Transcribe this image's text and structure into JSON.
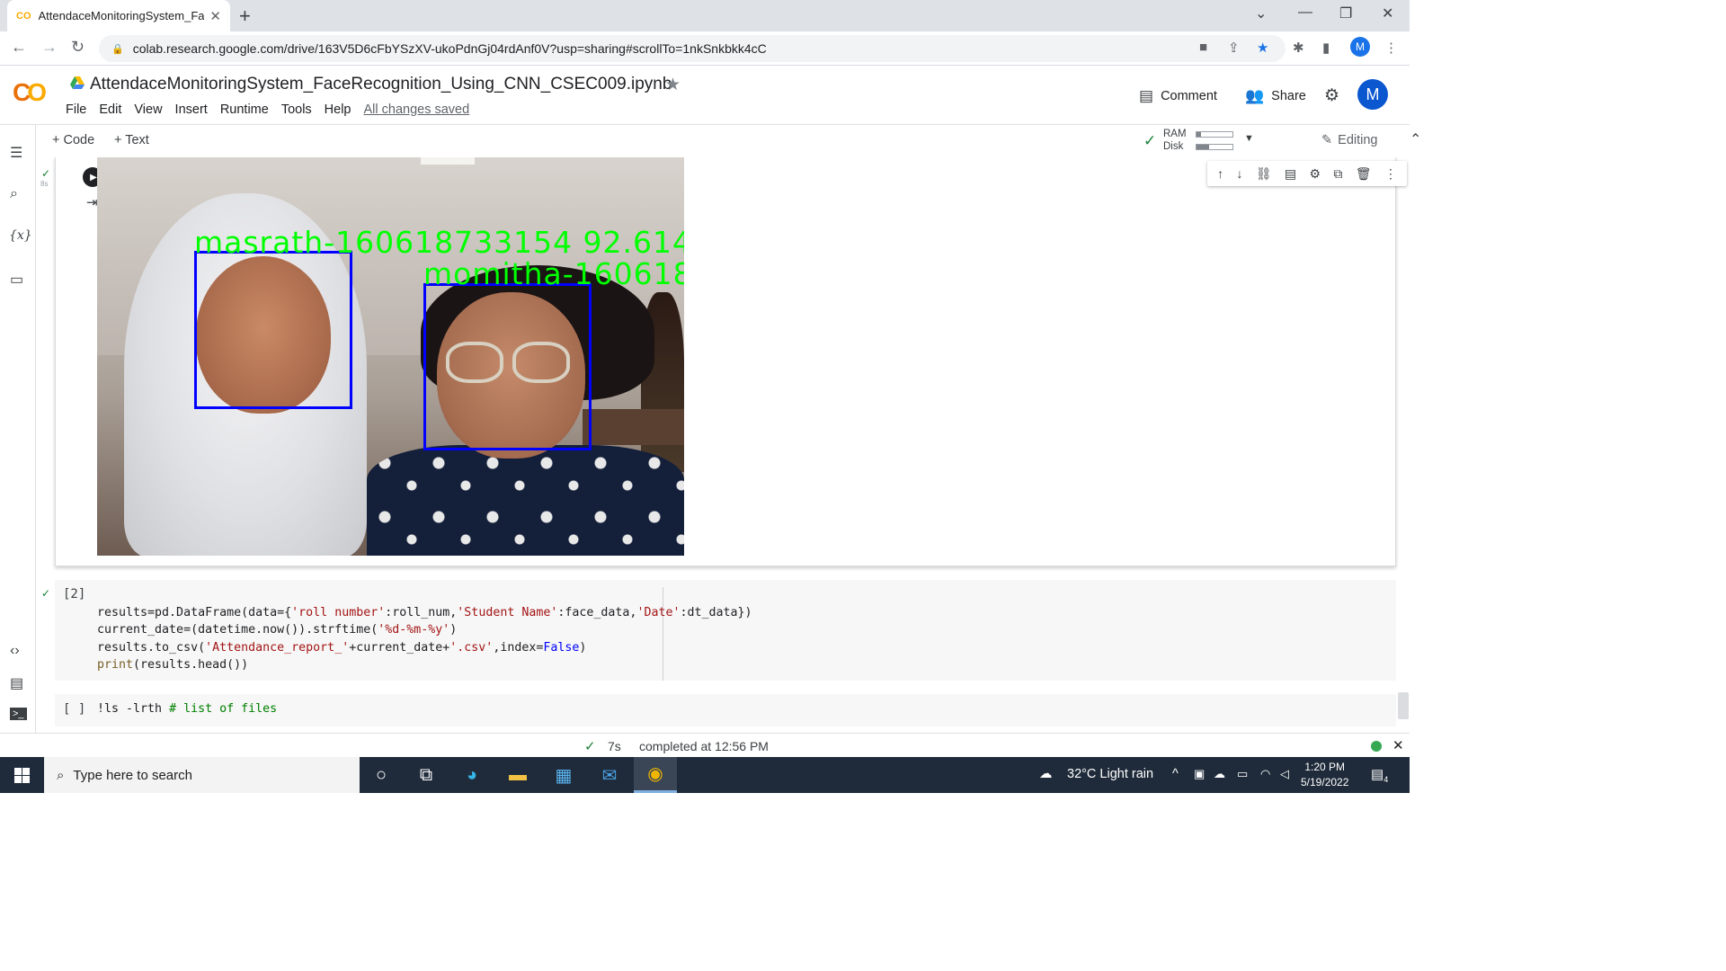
{
  "browser": {
    "tab_title": "AttendaceMonitoringSystem_Fac",
    "tab_favicon": "CO",
    "url": "colab.research.google.com/drive/163V5D6cFbYSzXV-ukoPdnGj04rdAnf0V?usp=sharing#scrollTo=1nkSnkbkk4cC",
    "profile_initial": "M"
  },
  "colab": {
    "logo": "CO",
    "notebook_title": "AttendaceMonitoringSystem_FaceRecognition_Using_CNN_CSEC009.ipynb",
    "menu": [
      "File",
      "Edit",
      "View",
      "Insert",
      "Runtime",
      "Tools",
      "Help"
    ],
    "saved_status": "All changes saved",
    "comment_label": "Comment",
    "share_label": "Share",
    "avatar_initial": "M"
  },
  "toolbar": {
    "add_code": "+ Code",
    "add_text": "+ Text",
    "ram_label": "RAM",
    "disk_label": "Disk",
    "ram_fraction": 0.12,
    "disk_fraction": 0.35,
    "editing_label": "Editing"
  },
  "cell1": {
    "exec_time": "8s",
    "detections": [
      {
        "label": "masrath-160618733154  92.614"
      },
      {
        "label": "momitha-160618"
      }
    ]
  },
  "cell2": {
    "exec_count": "[2]",
    "ruler_note": ""
  },
  "cell3": {
    "exec_count": "[ ]",
    "code_cmd": "!ls -lrth ",
    "code_comment": "# list of files"
  },
  "status": {
    "time": "7s",
    "message": "completed at 12:56 PM"
  },
  "taskbar": {
    "search_placeholder": "Type here to search",
    "weather": "32°C  Light rain",
    "time": "1:20 PM",
    "date": "5/19/2022",
    "notifications": "4"
  },
  "colors": {
    "colab_orange": "#f9ab00",
    "face_box": "#0000ff",
    "face_label": "#00ff00",
    "taskbar": "#1f2b3a"
  }
}
